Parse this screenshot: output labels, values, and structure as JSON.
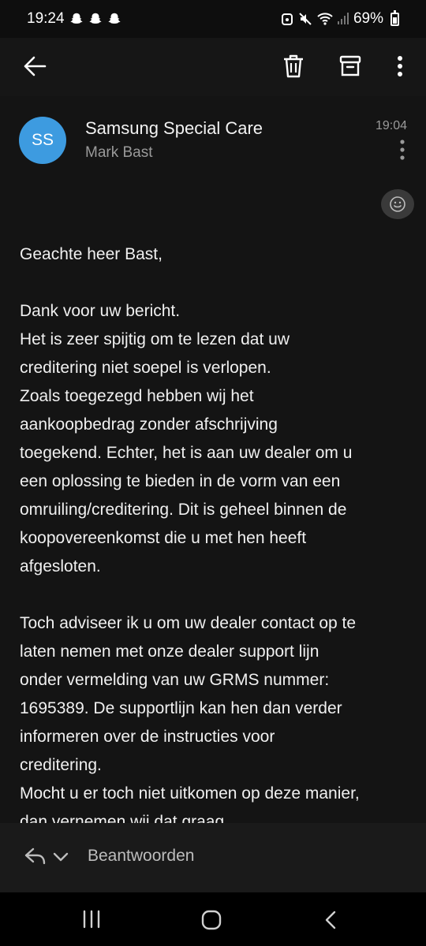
{
  "status_bar": {
    "time": "19:24",
    "battery": "69%",
    "battery_level": 0.69,
    "icons": [
      "snapchat-icon",
      "snapchat-icon",
      "snapchat-icon",
      "alarm-icon",
      "mute-icon",
      "wifi-icon",
      "signal-icon",
      "battery-icon"
    ]
  },
  "app_bar": {
    "icons": [
      "back-arrow-icon",
      "trash-icon",
      "archive-icon",
      "more-vertical-icon"
    ]
  },
  "email": {
    "avatar_initials": "SS",
    "sender": "Samsung Special Care",
    "recipient": "Mark Bast",
    "time": "19:04",
    "body": [
      "Geachte heer Bast,",
      "",
      "Dank voor uw bericht.",
      "Het is zeer spijtig om te lezen dat uw",
      "creditering niet soepel is verlopen.",
      "Zoals toegezegd hebben wij het",
      "aankoopbedrag zonder afschrijving",
      "toegekend. Echter, het is aan uw dealer om u",
      "een oplossing te bieden in de vorm van een",
      "omruiling/creditering. Dit is geheel binnen de",
      "koopovereenkomst die u met hen heeft",
      "afgesloten.",
      "",
      "Toch adviseer ik u om uw dealer contact op te",
      "laten nemen met onze dealer support lijn",
      "onder vermelding van uw GRMS nummer:",
      "1695389. De supportlijn kan hen dan verder",
      "informeren over de instructies voor",
      "creditering.",
      "Mocht u er toch niet uitkomen op deze manier,",
      "dan vernemen wij dat graag."
    ]
  },
  "reply_bar": {
    "label": "Beantwoorden"
  },
  "colors": {
    "avatar": "#3d9be0",
    "background": "#141414",
    "app_bar": "#161616"
  }
}
